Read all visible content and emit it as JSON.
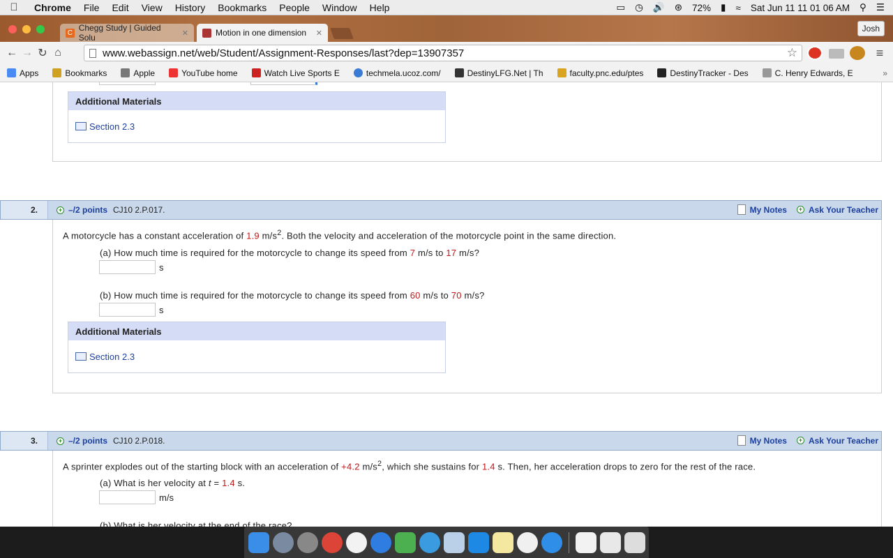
{
  "menubar": {
    "app": "Chrome",
    "items": [
      "File",
      "Edit",
      "View",
      "History",
      "Bookmarks",
      "People",
      "Window",
      "Help"
    ],
    "battery": "72%",
    "datetime": "Sat Jun 11  11 01 06 AM"
  },
  "browser": {
    "tabs": [
      {
        "label": "Chegg Study | Guided Solu",
        "icon_color": "#e56a1e"
      },
      {
        "label": "Motion in one dimension",
        "icon_color": "#a33"
      }
    ],
    "profile": "Josh",
    "url": "www.webassign.net/web/Student/Assignment-Responses/last?dep=13907357",
    "bookmarks": [
      {
        "label": "Apps",
        "color": "#4a8af4"
      },
      {
        "label": "Bookmarks",
        "color": "#d0a020"
      },
      {
        "label": "Apple",
        "color": "#777"
      },
      {
        "label": "YouTube home",
        "color": "#e33"
      },
      {
        "label": "Watch Live Sports E",
        "color": "#c22"
      },
      {
        "label": "techmela.ucoz.com/",
        "color": "#3a7bd5"
      },
      {
        "label": "DestinyLFG.Net | Th",
        "color": "#333"
      },
      {
        "label": "faculty.pnc.edu/ptes",
        "color": "#d9a520"
      },
      {
        "label": "DestinyTracker - Des",
        "color": "#222"
      },
      {
        "label": "C. Henry Edwards, E",
        "color": "#999"
      }
    ]
  },
  "previous": {
    "additional_materials": "Additional Materials",
    "section": "Section 2.3"
  },
  "questions": [
    {
      "number": "2.",
      "points": "–/2 points",
      "code": "CJ10 2.P.017.",
      "my_notes": "My Notes",
      "ask": "Ask Your Teacher",
      "text_a": "A motorcycle has a constant acceleration of ",
      "accel": "1.9",
      "text_b": " m/s",
      "text_c": ". Both the velocity and acceleration of the motorcycle point in the same direction.",
      "parts": [
        {
          "pre": "(a) How much time is required for the motorcycle to change its speed from ",
          "v1": "7",
          "mid": " m/s to ",
          "v2": "17",
          "post": " m/s?",
          "unit": "s"
        },
        {
          "pre": "(b) How much time is required for the motorcycle to change its speed from ",
          "v1": "60",
          "mid": " m/s to ",
          "v2": "70",
          "post": " m/s?",
          "unit": "s"
        }
      ],
      "additional_materials": "Additional Materials",
      "section": "Section 2.3"
    },
    {
      "number": "3.",
      "points": "–/2 points",
      "code": "CJ10 2.P.018.",
      "my_notes": "My Notes",
      "ask": "Ask Your Teacher",
      "text_a": "A sprinter explodes out of the starting block with an acceleration of ",
      "accel": "+4.2",
      "text_b": " m/s",
      "text_c": ", which she sustains for ",
      "time": "1.4",
      "text_d": " s. Then, her acceleration drops to zero for the rest of the race.",
      "part_a_pre": "(a) What is her velocity at ",
      "part_a_t": "t",
      "part_a_eq": " = ",
      "part_a_val": "1.4",
      "part_a_post": " s.",
      "part_a_unit": "m/s",
      "part_b": "(b) What is her velocity at the end of the race?"
    }
  ],
  "dock": [
    "#3b8ee8",
    "#7a8aa0",
    "#888",
    "#db4437",
    "#f2f2f2",
    "#2f7de1",
    "#4caf50",
    "#3a9be0",
    "#b9d0e8",
    "#1e88e5",
    "#f4e7a0",
    "#f0f0f0",
    "#2f8ee8",
    "#f2f2f2",
    "#e8e8e8",
    "#ddd"
  ]
}
